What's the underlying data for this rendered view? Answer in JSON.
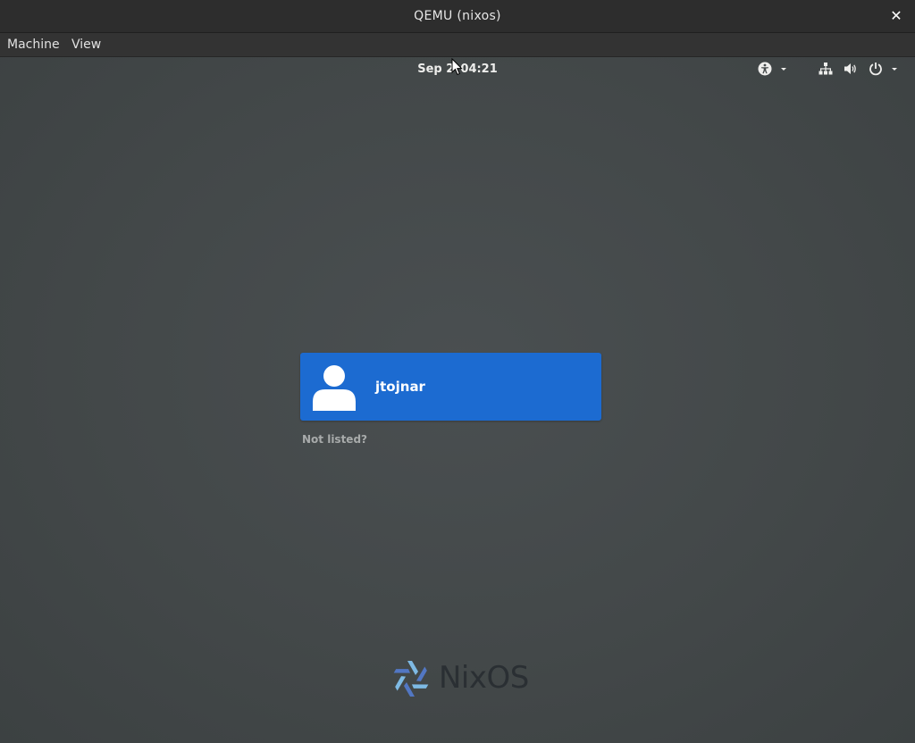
{
  "window": {
    "title": "QEMU (nixos)",
    "close_glyph": "✕"
  },
  "menubar": {
    "items": [
      {
        "label": "Machine"
      },
      {
        "label": "View"
      }
    ]
  },
  "gdm": {
    "clock": "Sep 2  04:21",
    "indicators": [
      "accessibility-icon",
      "network-icon",
      "volume-icon",
      "power-icon"
    ],
    "user_list": [
      {
        "username": "jtojnar",
        "avatar_icon": "user-avatar-icon"
      }
    ],
    "not_listed": "Not listed?",
    "logo_text": "NixOS"
  },
  "colors": {
    "background": "#454a4b",
    "user_card": "#1c6bd1",
    "logo_light": "#7ebae4",
    "logo_dark": "#5277c3"
  }
}
